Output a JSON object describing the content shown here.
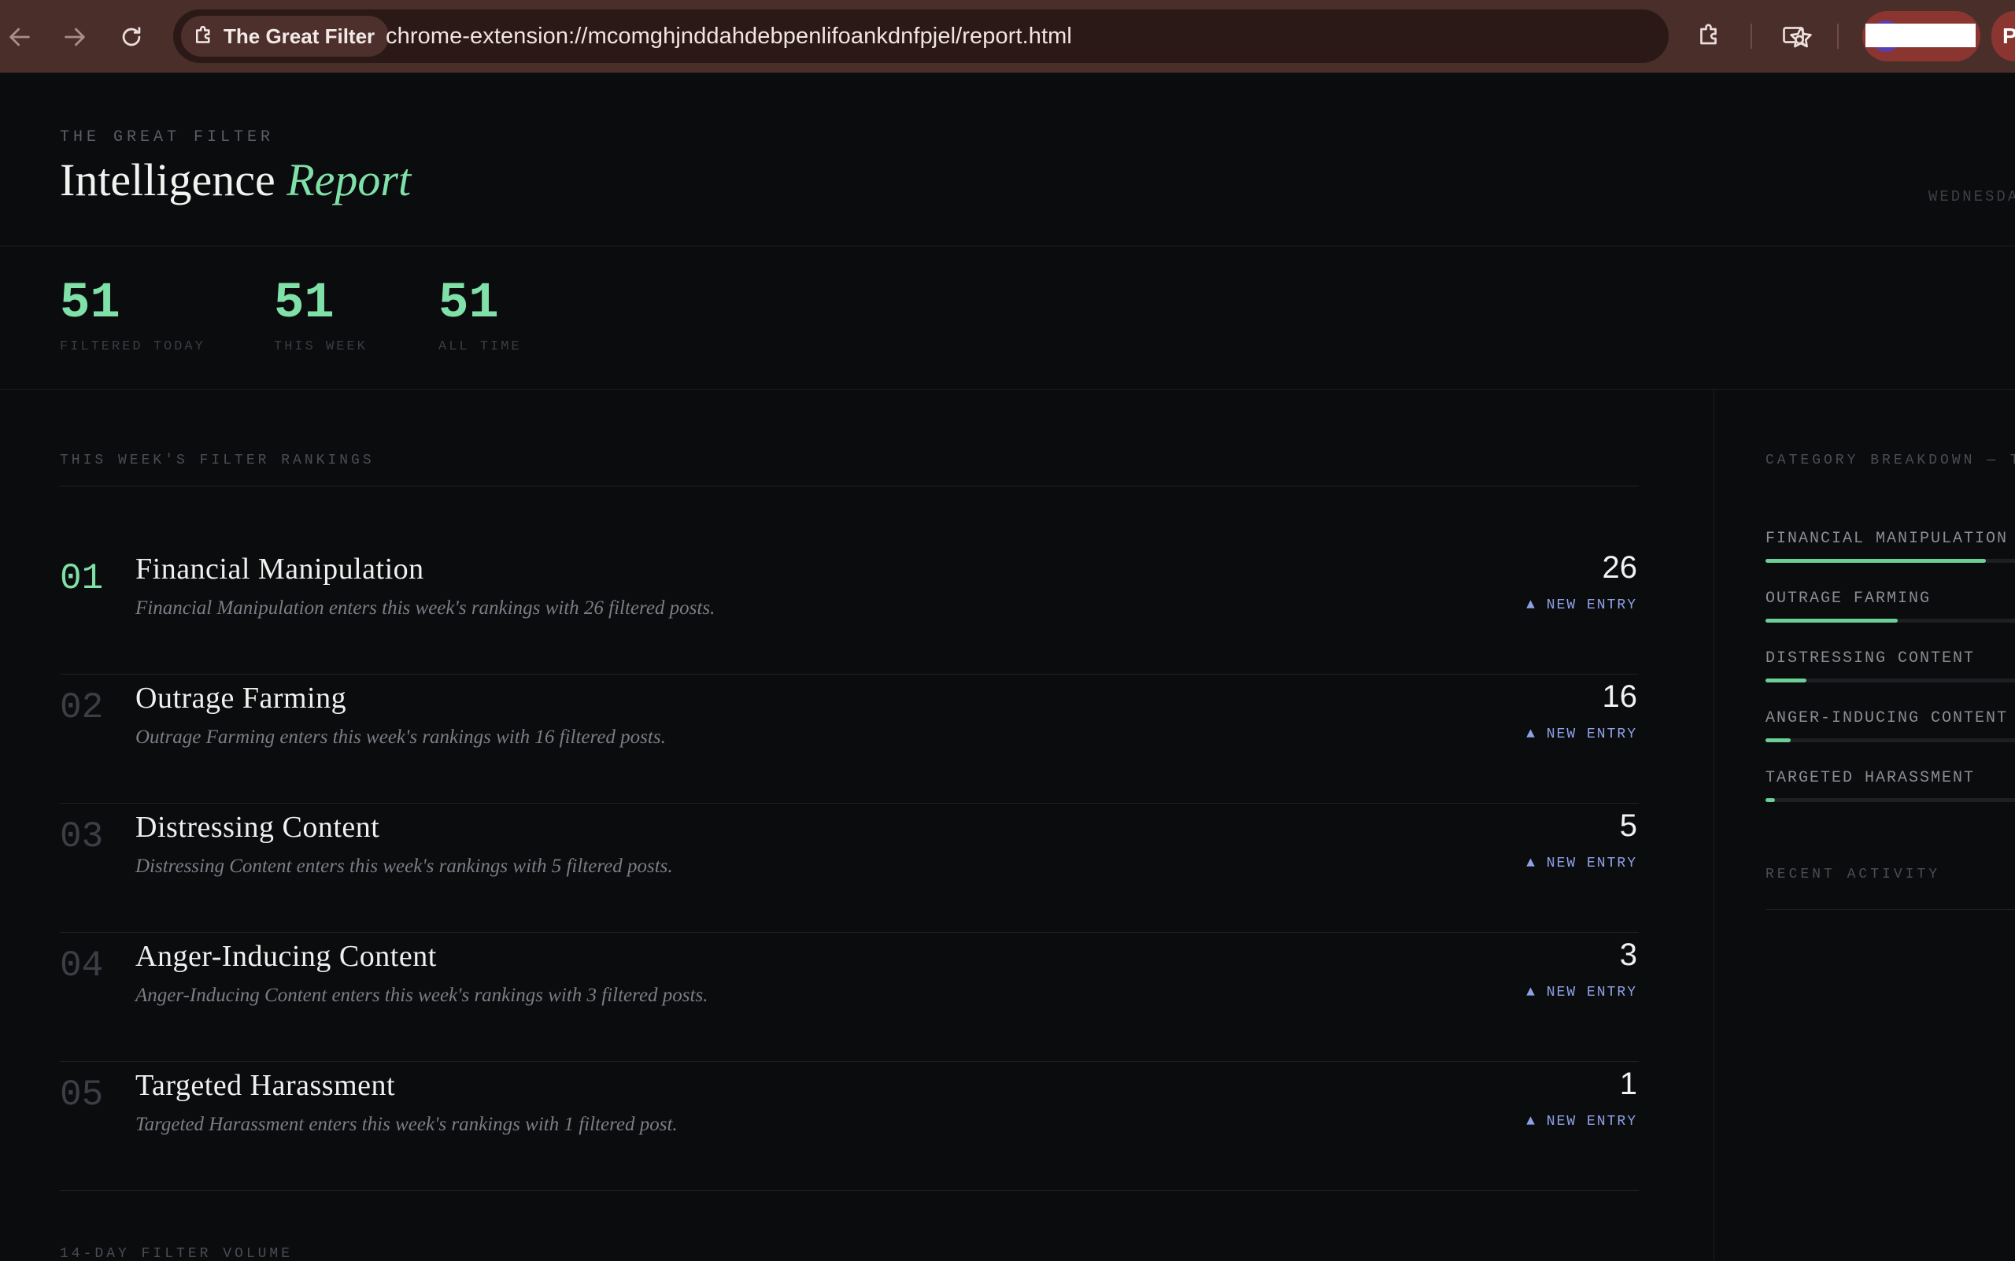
{
  "browser": {
    "site_chip": "The Great Filter",
    "url": "chrome-extension://mcomghjnddahdebpenlifoankdnfpjel/report.html",
    "profile_initial": "P"
  },
  "header": {
    "eyebrow": "THE GREAT FILTER",
    "title_main": "Intelligence",
    "title_accent": "Report",
    "date": "WEDNESDA"
  },
  "stats": [
    {
      "value": "51",
      "label": "FILTERED TODAY"
    },
    {
      "value": "51",
      "label": "THIS WEEK"
    },
    {
      "value": "51",
      "label": "ALL TIME"
    }
  ],
  "rankings": {
    "label": "THIS WEEK'S FILTER RANKINGS",
    "items": [
      {
        "rank": "01",
        "name": "Financial Manipulation",
        "desc": "Financial Manipulation enters this week's rankings with 26 filtered posts.",
        "count": "26",
        "badge": "▲ NEW ENTRY"
      },
      {
        "rank": "02",
        "name": "Outrage Farming",
        "desc": "Outrage Farming enters this week's rankings with 16 filtered posts.",
        "count": "16",
        "badge": "▲ NEW ENTRY"
      },
      {
        "rank": "03",
        "name": "Distressing Content",
        "desc": "Distressing Content enters this week's rankings with 5 filtered posts.",
        "count": "5",
        "badge": "▲ NEW ENTRY"
      },
      {
        "rank": "04",
        "name": "Anger-Inducing Content",
        "desc": "Anger-Inducing Content enters this week's rankings with 3 filtered posts.",
        "count": "3",
        "badge": "▲ NEW ENTRY"
      },
      {
        "rank": "05",
        "name": "Targeted Harassment",
        "desc": "Targeted Harassment enters this week's rankings with 1 filtered post.",
        "count": "1",
        "badge": "▲ NEW ENTRY"
      }
    ]
  },
  "volume_label": "14-DAY FILTER VOLUME",
  "sidebar": {
    "breakdown_label": "CATEGORY BREAKDOWN — TH",
    "categories": [
      {
        "label": "FINANCIAL MANIPULATION",
        "fraction": 0.7
      },
      {
        "label": "OUTRAGE FARMING",
        "fraction": 0.42
      },
      {
        "label": "DISTRESSING CONTENT",
        "fraction": 0.13
      },
      {
        "label": "ANGER-INDUCING CONTENT",
        "fraction": 0.08
      },
      {
        "label": "TARGETED HARASSMENT",
        "fraction": 0.03
      }
    ],
    "recent_label": "RECENT ACTIVITY"
  },
  "colors": {
    "accent": "#7fe0a8",
    "badge": "#8ea2e8",
    "chrome": "#4a2e2a"
  }
}
